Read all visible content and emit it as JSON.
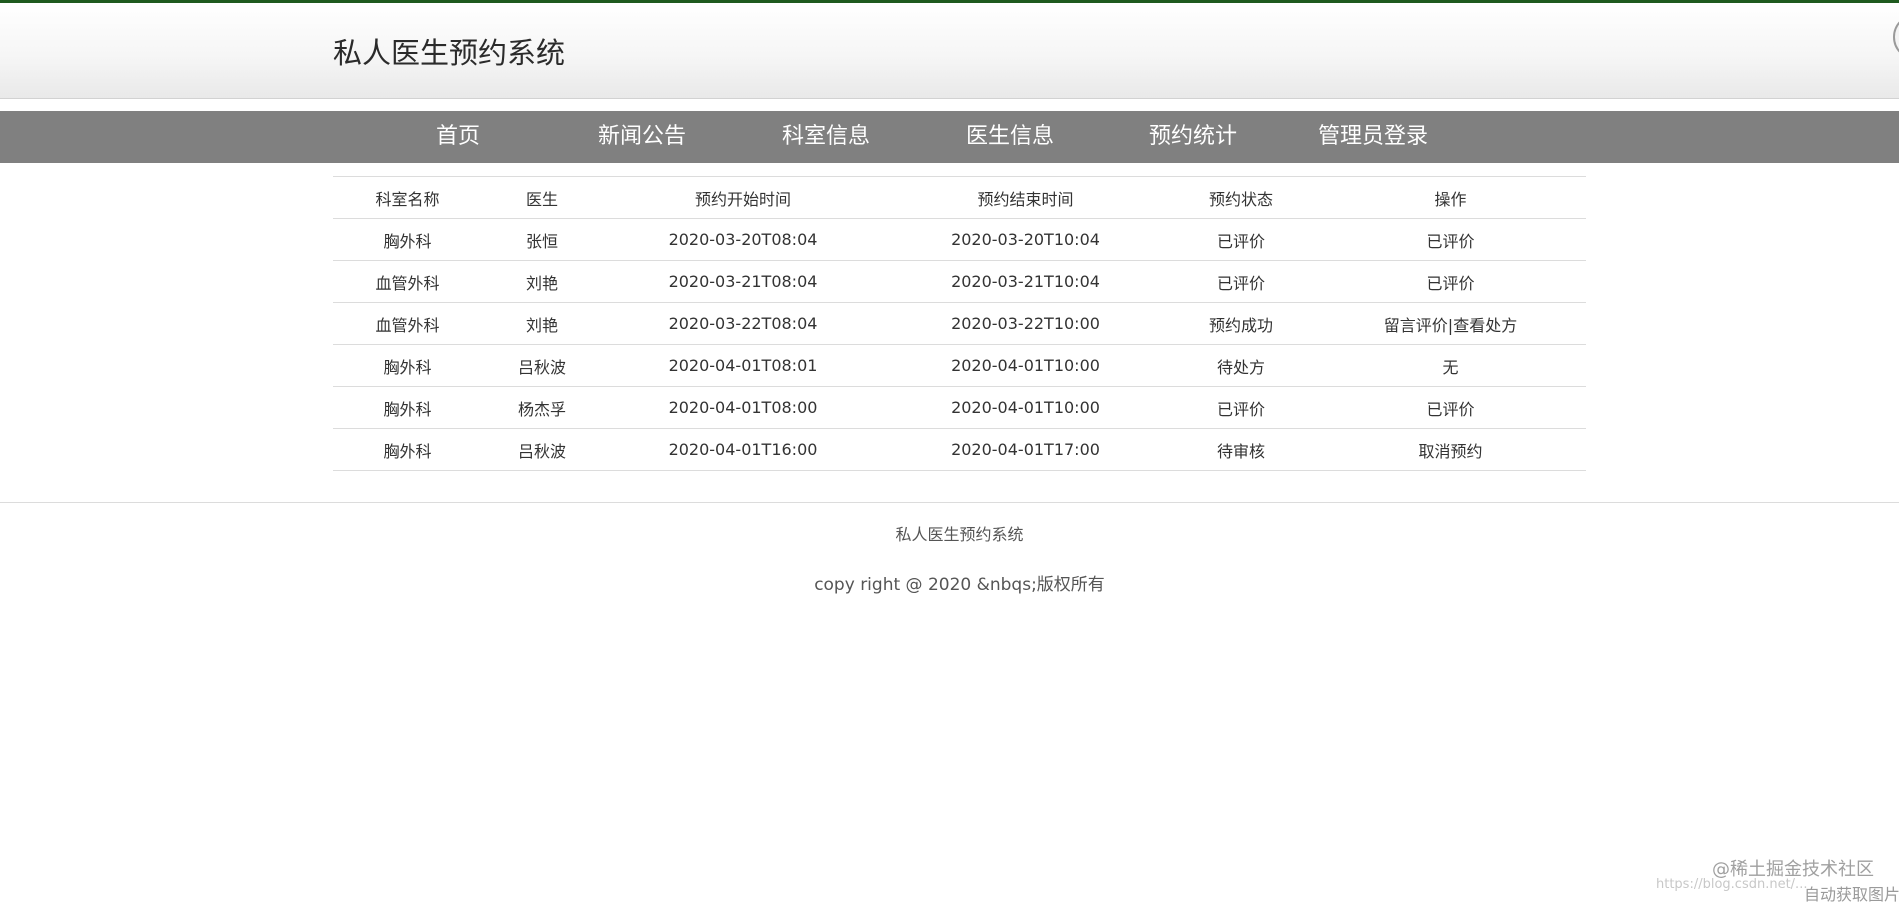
{
  "header": {
    "site_title": "私人医生预约系统"
  },
  "nav": {
    "items": [
      {
        "label": "首页"
      },
      {
        "label": "新闻公告"
      },
      {
        "label": "科室信息"
      },
      {
        "label": "医生信息"
      },
      {
        "label": "预约统计"
      },
      {
        "label": "管理员登录"
      }
    ]
  },
  "table": {
    "columns": [
      "科室名称",
      "医生",
      "预约开始时间",
      "预约结束时间",
      "预约状态",
      "操作"
    ],
    "rows": [
      {
        "dept": "胸外科",
        "doctor": "张恒",
        "start": "2020-03-20T08:04",
        "end": "2020-03-20T10:04",
        "status": "已评价",
        "action": "已评价"
      },
      {
        "dept": "血管外科",
        "doctor": "刘艳",
        "start": "2020-03-21T08:04",
        "end": "2020-03-21T10:04",
        "status": "已评价",
        "action": "已评价"
      },
      {
        "dept": "血管外科",
        "doctor": "刘艳",
        "start": "2020-03-22T08:04",
        "end": "2020-03-22T10:00",
        "status": "预约成功",
        "action": "留言评价|查看处方"
      },
      {
        "dept": "胸外科",
        "doctor": "吕秋波",
        "start": "2020-04-01T08:01",
        "end": "2020-04-01T10:00",
        "status": "待处方",
        "action": "无"
      },
      {
        "dept": "胸外科",
        "doctor": "杨杰孚",
        "start": "2020-04-01T08:00",
        "end": "2020-04-01T10:00",
        "status": "已评价",
        "action": "已评价"
      },
      {
        "dept": "胸外科",
        "doctor": "吕秋波",
        "start": "2020-04-01T16:00",
        "end": "2020-04-01T17:00",
        "status": "待审核",
        "action": "取消预约"
      }
    ]
  },
  "footer": {
    "name": "私人医生预约系统",
    "copyright": "copy right @ 2020 &nbqs;版权所有"
  },
  "watermark": {
    "main": "@稀土掘金技术社区",
    "url": "https://blog.csdn.net/...",
    "auto": "自动获取图片"
  }
}
